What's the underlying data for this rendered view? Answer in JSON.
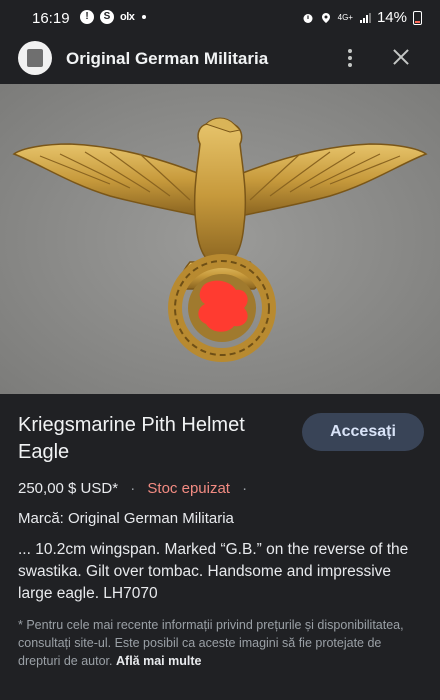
{
  "status_bar": {
    "time": "16:19",
    "left_icons": [
      "alert-icon",
      "s-app-icon",
      "olx-icon",
      "dot-icon"
    ],
    "olx": "olx",
    "network": "4G+",
    "battery": "14%"
  },
  "header": {
    "site_name": "Original German Militaria"
  },
  "product": {
    "title": "Kriegsmarine Pith Helmet Eagle",
    "visit_button": "Accesați",
    "price": "250,00 $ USD*",
    "stock": "Stoc epuizat",
    "brand": "Marcă: Original German Militaria",
    "description": "... 10.2cm wingspan. Marked “G.B.” on the reverse of the swastika. Gilt over tombac. Handsome and impressive large eagle. LH7070",
    "disclaimer": "* Pentru cele mai recente informații privind prețurile și disponibilitatea, consultați site-ul. Este posibil ca aceste imagini să fie protejate de drepturi de autor.",
    "learn_more": "Află mai multe"
  },
  "colors": {
    "background": "#202124",
    "button_bg": "#394457",
    "stock_red": "#f28b82"
  }
}
